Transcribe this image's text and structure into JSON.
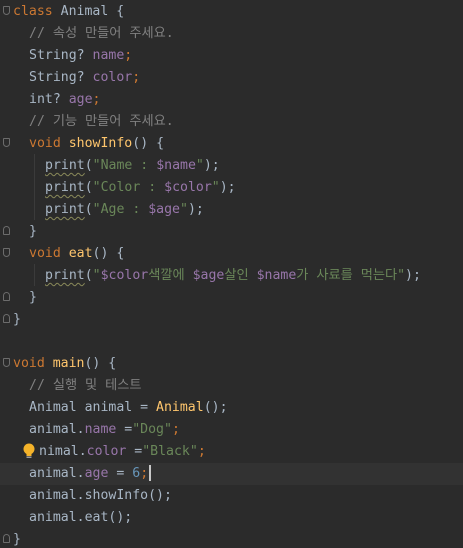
{
  "code": {
    "l1": {
      "kw": "class",
      "name": "Animal",
      "brace": "{"
    },
    "l2": {
      "comment": "// 속성 만들어 주세요."
    },
    "l3": {
      "type": "String?",
      "field": "name",
      "semi": ";"
    },
    "l4": {
      "type": "String?",
      "field": "color",
      "semi": ";"
    },
    "l5": {
      "type": "int?",
      "field": "age",
      "semi": ";"
    },
    "l6": {
      "comment": "// 기능 만들어 주세요."
    },
    "l7": {
      "kw": "void",
      "fn": "showInfo",
      "rest": "() {"
    },
    "l8": {
      "fn": "print",
      "open": "(",
      "s1": "\"Name : ",
      "var": "$name",
      "s2": "\"",
      "close": ");"
    },
    "l9": {
      "fn": "print",
      "open": "(",
      "s1": "\"Color : ",
      "var": "$color",
      "s2": "\"",
      "close": ");"
    },
    "l10": {
      "fn": "print",
      "open": "(",
      "s1": "\"Age : ",
      "var": "$age",
      "s2": "\"",
      "close": ");"
    },
    "l11": {
      "brace": "}"
    },
    "l12": {
      "kw": "void",
      "fn": "eat",
      "rest": "() {"
    },
    "l13": {
      "fn": "print",
      "open": "(",
      "s0": "\"",
      "v1": "$color",
      "s1": "색깔에 ",
      "v2": "$age",
      "s2": "살인 ",
      "v3": "$name",
      "s3": "가 사료를 먹는다\"",
      "close": ");"
    },
    "l14": {
      "brace": "}"
    },
    "l15": {
      "brace": "}"
    },
    "l17": {
      "kw": "void",
      "fn": "main",
      "rest": "() {"
    },
    "l18": {
      "comment": "// 실행 및 테스트"
    },
    "l19": {
      "a": "Animal animal = ",
      "fn": "Animal",
      "b": "();"
    },
    "l20": {
      "obj": "animal.",
      "field": "name",
      "eq": " =",
      "str": "\"Dog\"",
      "semi": ";"
    },
    "l21": {
      "obj": "nimal.",
      "field": "color",
      "eq": " =",
      "str": "\"Black\"",
      "semi": ";"
    },
    "l22": {
      "obj": "animal.",
      "field": "age",
      "eq": " = ",
      "num": "6",
      "semi": ";"
    },
    "l23": {
      "text": "animal.showInfo();"
    },
    "l24": {
      "text": "animal.eat();"
    },
    "l25": {
      "brace": "}"
    }
  },
  "colors": {
    "background": "#2b2b2b",
    "keyword": "#cc7832",
    "function": "#ffc66d",
    "field": "#9876aa",
    "string": "#6a8759",
    "number": "#6897bb",
    "comment": "#808080",
    "plain": "#a9b7c6"
  },
  "icons": {
    "intention": "lightbulb-icon"
  }
}
